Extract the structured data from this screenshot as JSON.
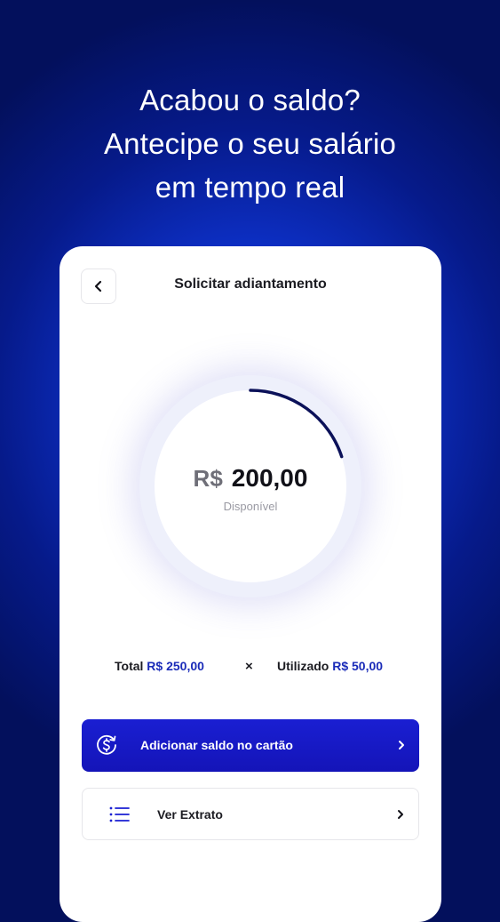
{
  "headline": {
    "line1": "Acabou o saldo?",
    "line2": "Antecipe o seu salário",
    "line3": "em tempo real"
  },
  "screen": {
    "title": "Solicitar adiantamento",
    "back_icon": "chevron-left-icon"
  },
  "gauge": {
    "currency": "R$",
    "amount": "200,00",
    "caption": "Disponível",
    "used_fraction": 0.2,
    "track_color": "#eef0fb",
    "progress_color": "#0b1159"
  },
  "totals": {
    "total_label": "Total",
    "total_value": "R$ 250,00",
    "separator": "×",
    "used_label": "Utilizado",
    "used_value": "R$ 50,00"
  },
  "actions": {
    "primary": {
      "label": "Adicionar saldo no cartão",
      "icon": "dollar-refresh-icon",
      "chevron": "chevron-right-icon"
    },
    "secondary": {
      "label": "Ver Extrato",
      "icon": "list-icon",
      "chevron": "chevron-right-icon"
    }
  },
  "colors": {
    "brand_blue": "#1a1fd2",
    "accent_text": "#1a2bb8"
  }
}
